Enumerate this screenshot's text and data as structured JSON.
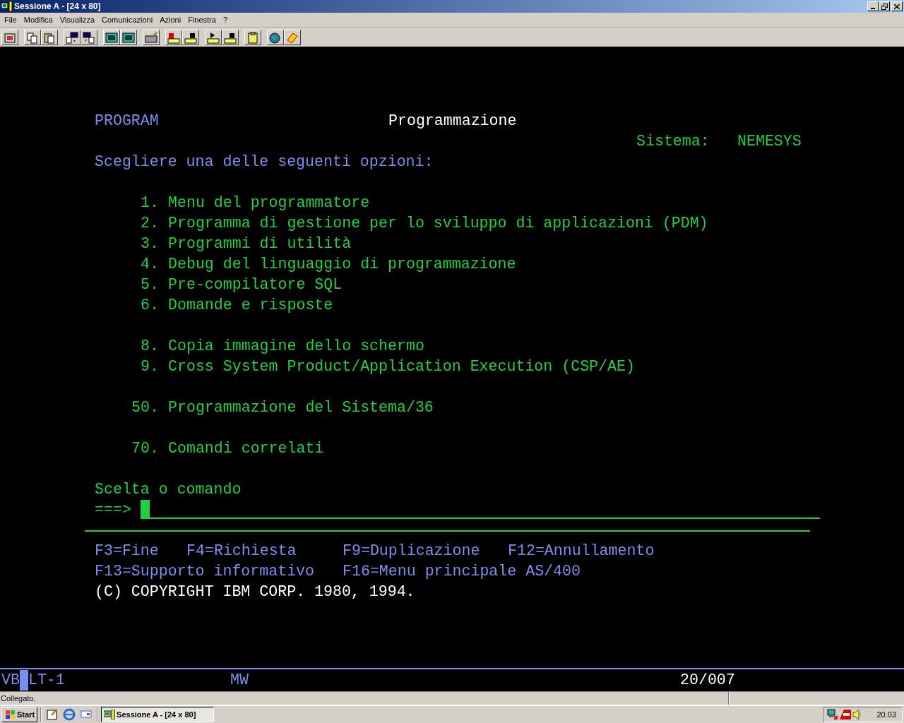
{
  "window": {
    "title": "Sessione A - [24 x 80]"
  },
  "menu": [
    "File",
    "Modifica",
    "Visualizza",
    "Comunicazioni",
    "Azioni",
    "Finestra",
    "?"
  ],
  "screen": {
    "program_id": "PROGRAM",
    "title": "Programmazione",
    "system_label": "Sistema:",
    "system_name": "NEMESYS",
    "instruction": "Scegliere una delle seguenti opzioni:",
    "option_groups": [
      [
        {
          "number": "1.",
          "label": "Menu del programmatore"
        },
        {
          "number": "2.",
          "label": "Programma di gestione per lo sviluppo di applicazioni (PDM)"
        },
        {
          "number": "3.",
          "label": "Programmi di utilità"
        },
        {
          "number": "4.",
          "label": "Debug del linguaggio di programmazione"
        },
        {
          "number": "5.",
          "label": "Pre-compilatore SQL"
        },
        {
          "number": "6.",
          "label": "Domande e risposte"
        }
      ],
      [
        {
          "number": "8.",
          "label": "Copia immagine dello schermo"
        },
        {
          "number": "9.",
          "label": "Cross System Product/Application Execution (CSP/AE)"
        }
      ],
      [
        {
          "number": "50.",
          "label": "Programmazione del Sistema/36"
        }
      ],
      [
        {
          "number": "70.",
          "label": "Comandi correlati"
        }
      ]
    ],
    "prompt_label": "Scelta o comando",
    "prompt_arrow": "===>",
    "function_keys": [
      [
        "F3=Fine",
        "F4=Richiesta",
        "F9=Duplicazione",
        "F12=Annullamento"
      ],
      [
        "F13=Supporto informativo",
        "F16=Menu principale AS/400"
      ]
    ],
    "copyright": "(C) COPYRIGHT IBM CORP. 1980, 1994."
  },
  "status_line": {
    "indicator": "VB",
    "device": "LT-1",
    "mode": "MW",
    "position": "20/007"
  },
  "connection_status": "Collegato.",
  "taskbar": {
    "start": "Start",
    "tasks": [
      {
        "label": "Sessione A - [24 x 80]",
        "selected": true
      }
    ],
    "clock": "20.03"
  }
}
